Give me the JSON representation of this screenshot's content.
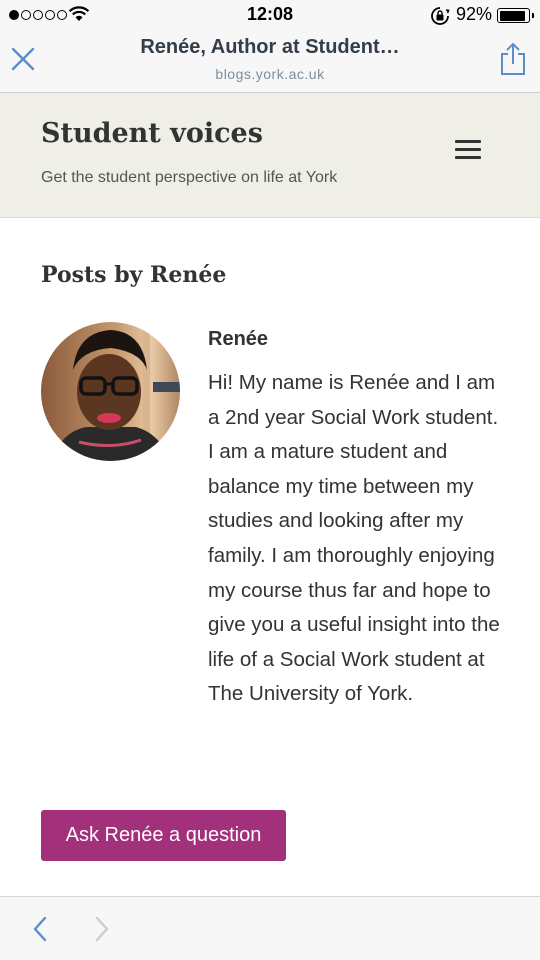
{
  "status_bar": {
    "time": "12:08",
    "battery_percent": "92%",
    "battery_level": 0.92,
    "signal_bars": 1,
    "signal_total": 5
  },
  "browser": {
    "page_title": "Renée, Author at Student…",
    "domain": "blogs.york.ac.uk",
    "icons": {
      "close": "close-icon",
      "share": "share-icon",
      "back": "back-chevron-icon",
      "forward": "forward-chevron-icon"
    }
  },
  "site": {
    "title": "Student voices",
    "tagline": "Get the student perspective on life at York",
    "menu_icon": "hamburger-menu-icon"
  },
  "main": {
    "heading": "Posts by Renée",
    "author": {
      "name": "Renée",
      "bio": "Hi! My name is Renée and I am a 2nd year Social Work student. I am a mature student and balance my time between my studies and looking after my family. I am thoroughly enjoying my course thus far and hope to give you a useful insight into the life of a Social Work student at The University of York."
    },
    "ask_button_label": "Ask Renée a question"
  },
  "colors": {
    "accent": "#a3307b",
    "site_header_bg": "#efefe7",
    "browser_chrome": "#f7f7f7",
    "link_blue": "#5a8ec9"
  }
}
